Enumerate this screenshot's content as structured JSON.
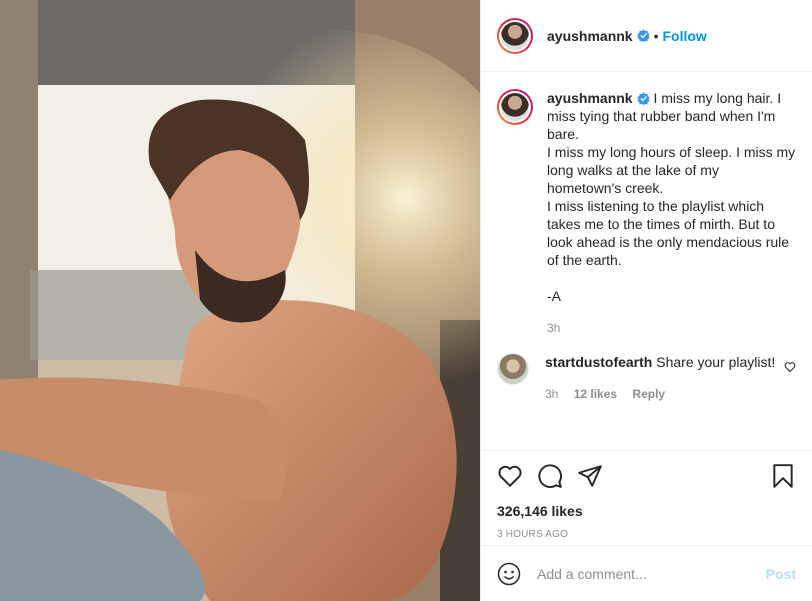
{
  "post": {
    "username": "ayushmannk",
    "follow_label": "Follow",
    "dot": "•",
    "caption_lines": [
      "I miss my long hair. I miss tying that rubber band when I'm bare.",
      "I miss my long hours of sleep. I miss my long walks at the lake of my hometown's creek.",
      "I miss listening to the playlist which takes me to the times of mirth. But to look ahead is the only mendacious rule of the earth."
    ],
    "signature": "-A",
    "caption_time": "3h"
  },
  "reply": {
    "username": "startdustofearth",
    "text": "Share your playlist!",
    "time": "3h",
    "likes": "12 likes",
    "reply_label": "Reply"
  },
  "stats": {
    "likes": "326,146 likes",
    "posted": "3 HOURS AGO"
  },
  "add_comment": {
    "placeholder": "Add a comment...",
    "post_label": "Post"
  },
  "icons": {
    "like": "heart-icon",
    "comment": "comment-icon",
    "share": "share-icon",
    "save": "bookmark-icon",
    "emoji": "emoji-icon",
    "verified": "verified-badge-icon"
  },
  "colors": {
    "accent": "#0095f6",
    "post_disabled": "#b2dffc",
    "muted": "#8e8e8e"
  }
}
